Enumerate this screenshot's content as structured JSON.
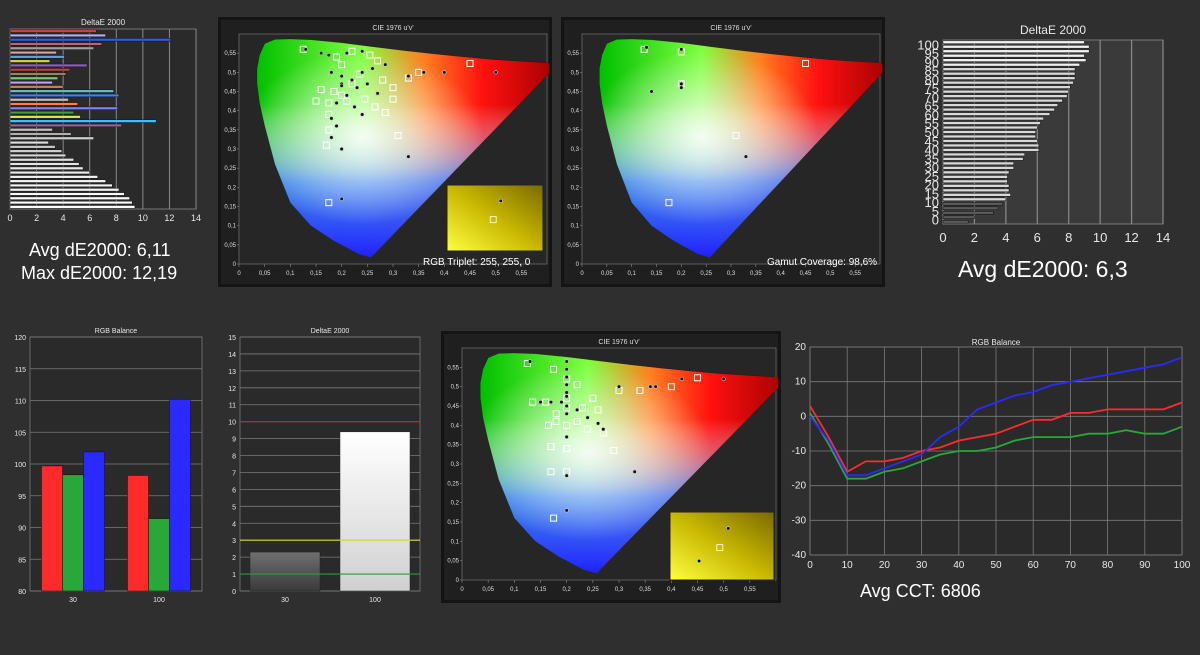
{
  "summary": {
    "grayscale_avg": "Avg dE2000: 6,11",
    "grayscale_max": "Max dE2000: 12,19",
    "gamut_avg": "Avg dE2000: 6,3",
    "avg_cct": "Avg CCT: 6806",
    "rgb_triplet": "RGB Triplet: 255, 255, 0",
    "gamut_coverage": "Gamut Coverage: 98,6%"
  },
  "colors": {
    "red": "#ff2a2a",
    "green": "#28a838",
    "blue": "#2a2aff",
    "gridline": "#6a6a6a",
    "panel_bg": "#2b2b2b",
    "frame_bg": "#1c1c1c",
    "threshold_red": "#d02020",
    "threshold_yellow": "#d8d820",
    "threshold_green": "#20a040"
  },
  "chart_data": [
    {
      "type": "bar",
      "title": "DeltaE 2000",
      "orientation": "horizontal",
      "xlim": [
        0,
        14
      ],
      "xticks": [
        "0",
        "2",
        "4",
        "6",
        "8",
        "10",
        "12",
        "14"
      ],
      "values": [
        6.5,
        7.2,
        12.1,
        6.9,
        6.3,
        3.5,
        4.1,
        3.0,
        5.8,
        4.5,
        4.2,
        3.6,
        3.2,
        4.0,
        7.8,
        8.2,
        4.4,
        5.1,
        8.1,
        4.8,
        5.3,
        11.0,
        8.4,
        3.2,
        4.6,
        6.3,
        2.9,
        3.4,
        3.9,
        4.2,
        4.8,
        5.2,
        5.5,
        6.0,
        6.6,
        7.2,
        7.7,
        8.2,
        8.6,
        9.0,
        9.2,
        9.4
      ],
      "bar_colors": [
        "#d04040",
        "#b0b0f0",
        "#3060e0",
        "#c06080",
        "#a0a0a0",
        "#e0a0a0",
        "#60a0e0",
        "#d0d040",
        "#9060c0",
        "#c04040",
        "#a08060",
        "#70d070",
        "#c0a0ff",
        "#d08040",
        "#60c0c0",
        "#4080ff",
        "#c0c0c0",
        "#ff8040",
        "#8080ff",
        "#40a040",
        "#e0e060",
        "#40c0ff",
        "#a060a0",
        "#c0c0c0",
        "#b0b0b0",
        "#d0d0d0",
        "#e0e0e0",
        "#c8c8c8",
        "#d0d0d0",
        "#d8d8d8",
        "#e0e0e0",
        "#e4e4e4",
        "#e8e8e8",
        "#ececec",
        "#f0f0f0",
        "#f2f2f2",
        "#f4f4f4",
        "#f6f6f6",
        "#f8f8f8",
        "#fafafa",
        "#fcfcfc",
        "#ffffff"
      ]
    },
    {
      "type": "scatter",
      "title": "CIE 1976 u'v'",
      "xticks": [
        "0",
        "0,05",
        "0,1",
        "0,15",
        "0,2",
        "0,25",
        "0,3",
        "0,35",
        "0,4",
        "0,45",
        "0,5",
        "0,55"
      ],
      "yticks": [
        "0",
        "0,05",
        "0,1",
        "0,15",
        "0,2",
        "0,25",
        "0,3",
        "0,35",
        "0,4",
        "0,45",
        "0,5",
        "0,55"
      ],
      "xlim": [
        0,
        0.6
      ],
      "ylim": [
        0,
        0.6
      ],
      "targets": [
        [
          0.125,
          0.56
        ],
        [
          0.2,
          0.52
        ],
        [
          0.27,
          0.53
        ],
        [
          0.35,
          0.5
        ],
        [
          0.45,
          0.523
        ],
        [
          0.235,
          0.495
        ],
        [
          0.28,
          0.48
        ],
        [
          0.3,
          0.46
        ],
        [
          0.33,
          0.485
        ],
        [
          0.22,
          0.47
        ],
        [
          0.16,
          0.455
        ],
        [
          0.185,
          0.45
        ],
        [
          0.2,
          0.44
        ],
        [
          0.175,
          0.42
        ],
        [
          0.15,
          0.425
        ],
        [
          0.21,
          0.425
        ],
        [
          0.245,
          0.43
        ],
        [
          0.265,
          0.41
        ],
        [
          0.285,
          0.395
        ],
        [
          0.3,
          0.43
        ],
        [
          0.175,
          0.39
        ],
        [
          0.175,
          0.35
        ],
        [
          0.17,
          0.31
        ],
        [
          0.31,
          0.335
        ],
        [
          0.19,
          0.54
        ],
        [
          0.22,
          0.555
        ],
        [
          0.255,
          0.545
        ],
        [
          0.175,
          0.16
        ]
      ],
      "measured": [
        [
          0.13,
          0.56
        ],
        [
          0.16,
          0.55
        ],
        [
          0.175,
          0.545
        ],
        [
          0.21,
          0.55
        ],
        [
          0.24,
          0.555
        ],
        [
          0.18,
          0.5
        ],
        [
          0.2,
          0.49
        ],
        [
          0.22,
          0.48
        ],
        [
          0.24,
          0.5
        ],
        [
          0.26,
          0.51
        ],
        [
          0.285,
          0.52
        ],
        [
          0.23,
          0.46
        ],
        [
          0.25,
          0.47
        ],
        [
          0.27,
          0.445
        ],
        [
          0.2,
          0.47
        ],
        [
          0.2,
          0.465
        ],
        [
          0.21,
          0.44
        ],
        [
          0.19,
          0.42
        ],
        [
          0.225,
          0.41
        ],
        [
          0.24,
          0.39
        ],
        [
          0.18,
          0.38
        ],
        [
          0.19,
          0.36
        ],
        [
          0.18,
          0.33
        ],
        [
          0.2,
          0.3
        ],
        [
          0.33,
          0.49
        ],
        [
          0.36,
          0.5
        ],
        [
          0.4,
          0.5
        ],
        [
          0.5,
          0.5
        ],
        [
          0.2,
          0.17
        ],
        [
          0.33,
          0.28
        ]
      ],
      "inset_triplet": "255, 255, 0"
    },
    {
      "type": "scatter",
      "title": "CIE 1976 u'v'",
      "xticks": [
        "0",
        "0,05",
        "0,1",
        "0,15",
        "0,2",
        "0,25",
        "0,3",
        "0,35",
        "0,4",
        "0,45",
        "0,5",
        "0,55"
      ],
      "yticks": [
        "0",
        "0,05",
        "0,1",
        "0,15",
        "0,2",
        "0,25",
        "0,3",
        "0,35",
        "0,4",
        "0,45",
        "0,5",
        "0,55"
      ],
      "xlim": [
        0,
        0.6
      ],
      "ylim": [
        0,
        0.6
      ],
      "targets": [
        [
          0.125,
          0.56
        ],
        [
          0.2,
          0.47
        ],
        [
          0.45,
          0.523
        ],
        [
          0.31,
          0.335
        ],
        [
          0.175,
          0.16
        ],
        [
          0.2,
          0.553
        ]
      ],
      "measured": [
        [
          0.13,
          0.565
        ],
        [
          0.2,
          0.56
        ],
        [
          0.2,
          0.47
        ],
        [
          0.2,
          0.46
        ],
        [
          0.14,
          0.45
        ],
        [
          0.33,
          0.28
        ]
      ],
      "gamut_coverage_pct": 98.6
    },
    {
      "type": "bar",
      "title": "DeltaE 2000",
      "orientation": "horizontal",
      "xlim": [
        0,
        14
      ],
      "xticks": [
        "0",
        "2",
        "4",
        "6",
        "8",
        "10",
        "12",
        "14"
      ],
      "yticks": [
        "100",
        "95",
        "90",
        "85",
        "80",
        "75",
        "70",
        "65",
        "60",
        "55",
        "50",
        "45",
        "40",
        "35",
        "30",
        "25",
        "20",
        "15",
        "10",
        "5",
        "0"
      ],
      "categories": [
        "100",
        "97.5",
        "95",
        "92.5",
        "90",
        "87.5",
        "85",
        "82.5",
        "80",
        "77.5",
        "75",
        "72.5",
        "70",
        "67.5",
        "65",
        "62.5",
        "60",
        "57.5",
        "55",
        "52.5",
        "50",
        "47.5",
        "45",
        "42.5",
        "40",
        "37.5",
        "35",
        "32.5",
        "30",
        "27.5",
        "25",
        "22.5",
        "20",
        "17.5",
        "15",
        "12.5",
        "10",
        "7.5",
        "5",
        "2.5",
        "0"
      ],
      "values": [
        9.0,
        9.3,
        9.3,
        9.0,
        9.1,
        8.7,
        8.4,
        8.4,
        8.4,
        8.3,
        8.1,
        8.0,
        7.9,
        7.6,
        7.3,
        7.1,
        6.8,
        6.4,
        6.2,
        6.0,
        5.9,
        5.9,
        6.0,
        6.1,
        6.1,
        5.2,
        5.1,
        4.5,
        4.5,
        4.2,
        4.1,
        4.1,
        4.2,
        4.2,
        4.3,
        4.0,
        3.8,
        3.5,
        3.2,
        2.0,
        1.6
      ]
    },
    {
      "type": "bar",
      "title": "RGB Balance",
      "categories": [
        "30",
        "100"
      ],
      "ylim": [
        80,
        120
      ],
      "yticks": [
        "120",
        "115",
        "110",
        "105",
        "100",
        "95",
        "90",
        "85",
        "80"
      ],
      "series": [
        {
          "name": "R",
          "values": [
            99.7,
            98.2
          ]
        },
        {
          "name": "G",
          "values": [
            98.3,
            91.4
          ]
        },
        {
          "name": "B",
          "values": [
            101.9,
            110.2
          ]
        }
      ]
    },
    {
      "type": "bar",
      "title": "DeltaE 2000",
      "categories": [
        "30",
        "100"
      ],
      "ylim": [
        0,
        15
      ],
      "yticks": [
        "15",
        "14",
        "13",
        "12",
        "11",
        "10",
        "9",
        "8",
        "7",
        "6",
        "5",
        "4",
        "3",
        "2",
        "1",
        "0"
      ],
      "values": [
        2.3,
        9.4
      ],
      "thresholds": [
        10,
        3,
        1
      ]
    },
    {
      "type": "scatter",
      "title": "CIE 1976 u'v'",
      "xticks": [
        "0",
        "0,05",
        "0,1",
        "0,15",
        "0,2",
        "0,25",
        "0,3",
        "0,35",
        "0,4",
        "0,45",
        "0,5",
        "0,55"
      ],
      "yticks": [
        "0",
        "0,05",
        "0,1",
        "0,15",
        "0,2",
        "0,25",
        "0,3",
        "0,35",
        "0,4",
        "0,45",
        "0,5",
        "0,55"
      ],
      "xlim": [
        0,
        0.6
      ],
      "ylim": [
        0,
        0.6
      ],
      "targets": [
        [
          0.125,
          0.56
        ],
        [
          0.175,
          0.545
        ],
        [
          0.2,
          0.52
        ],
        [
          0.22,
          0.505
        ],
        [
          0.135,
          0.46
        ],
        [
          0.16,
          0.46
        ],
        [
          0.2,
          0.47
        ],
        [
          0.25,
          0.47
        ],
        [
          0.3,
          0.49
        ],
        [
          0.34,
          0.49
        ],
        [
          0.4,
          0.5
        ],
        [
          0.45,
          0.523
        ],
        [
          0.18,
          0.43
        ],
        [
          0.2,
          0.445
        ],
        [
          0.23,
          0.445
        ],
        [
          0.26,
          0.44
        ],
        [
          0.165,
          0.4
        ],
        [
          0.18,
          0.41
        ],
        [
          0.2,
          0.4
        ],
        [
          0.22,
          0.41
        ],
        [
          0.24,
          0.39
        ],
        [
          0.27,
          0.38
        ],
        [
          0.17,
          0.345
        ],
        [
          0.2,
          0.34
        ],
        [
          0.29,
          0.335
        ],
        [
          0.17,
          0.28
        ],
        [
          0.2,
          0.28
        ],
        [
          0.175,
          0.16
        ]
      ],
      "measured": [
        [
          0.13,
          0.565
        ],
        [
          0.2,
          0.565
        ],
        [
          0.2,
          0.545
        ],
        [
          0.2,
          0.525
        ],
        [
          0.2,
          0.505
        ],
        [
          0.2,
          0.485
        ],
        [
          0.2,
          0.475
        ],
        [
          0.15,
          0.46
        ],
        [
          0.17,
          0.46
        ],
        [
          0.19,
          0.46
        ],
        [
          0.2,
          0.45
        ],
        [
          0.2,
          0.43
        ],
        [
          0.22,
          0.44
        ],
        [
          0.24,
          0.42
        ],
        [
          0.26,
          0.405
        ],
        [
          0.27,
          0.39
        ],
        [
          0.3,
          0.5
        ],
        [
          0.36,
          0.5
        ],
        [
          0.37,
          0.5
        ],
        [
          0.42,
          0.52
        ],
        [
          0.5,
          0.52
        ],
        [
          0.2,
          0.37
        ],
        [
          0.2,
          0.27
        ],
        [
          0.2,
          0.18
        ],
        [
          0.33,
          0.28
        ]
      ]
    },
    {
      "type": "line",
      "title": "RGB Balance",
      "x": [
        0,
        5,
        10,
        15,
        20,
        25,
        30,
        35,
        40,
        45,
        50,
        55,
        60,
        65,
        70,
        75,
        80,
        85,
        90,
        95,
        100
      ],
      "xlim": [
        0,
        100
      ],
      "ylim": [
        -40,
        20
      ],
      "xticks": [
        "0",
        "10",
        "20",
        "30",
        "40",
        "50",
        "60",
        "70",
        "80",
        "90",
        "100"
      ],
      "yticks": [
        "20",
        "10",
        "0",
        "-10",
        "-20",
        "-30",
        "-40"
      ],
      "series": [
        {
          "name": "R",
          "values": [
            3,
            -6,
            -16,
            -13,
            -13,
            -12,
            -10,
            -9,
            -7,
            -6,
            -5,
            -3,
            -1,
            -1,
            1,
            1,
            2,
            2,
            2,
            2,
            4
          ]
        },
        {
          "name": "G",
          "values": [
            1,
            -8,
            -18,
            -18,
            -16,
            -15,
            -13,
            -11,
            -10,
            -10,
            -9,
            -7,
            -6,
            -6,
            -6,
            -5,
            -5,
            -4,
            -5,
            -5,
            -3
          ]
        },
        {
          "name": "B",
          "values": [
            0,
            -7,
            -17,
            -17,
            -15,
            -13,
            -11,
            -6,
            -3,
            2,
            4,
            6,
            7,
            9,
            10,
            11,
            12,
            13,
            14,
            15,
            17
          ]
        }
      ]
    }
  ]
}
